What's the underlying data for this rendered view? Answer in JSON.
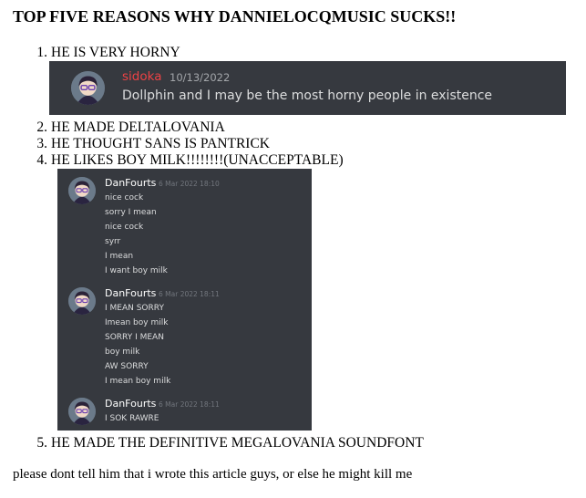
{
  "page": {
    "title": "TOP FIVE REASONS WHY DANNIELOCQMUSIC SUCKS!!",
    "closing": "please dont tell him that i wrote this article guys, or else he might kill me"
  },
  "list": [
    {
      "num": "1.",
      "text": "HE IS VERY HORNY"
    },
    {
      "num": "2.",
      "text": "HE MADE DELTALOVANIA"
    },
    {
      "num": "3.",
      "text": "HE THOUGHT SANS IS PANTRICK"
    },
    {
      "num": "4.",
      "text": "HE LIKES BOY MILK!!!!!!!!(UNACCEPTABLE)"
    },
    {
      "num": "5.",
      "text": "HE MADE THE DEFINITIVE MEGALOVANIA SOUNDFONT"
    }
  ],
  "embed1": {
    "username": "sidoka",
    "username_color": "#ed4245",
    "timestamp": "10/13/2022",
    "message": "Dollphin and I may be the most horny people in existence"
  },
  "embed2": {
    "groups": [
      {
        "username": "DanFourts",
        "timestamp": "6 Mar 2022 18:10",
        "lines": [
          "nice cock",
          "sorry I mean",
          "nice cock",
          "syrr",
          "I mean",
          "I want boy milk"
        ]
      },
      {
        "username": "DanFourts",
        "timestamp": "6 Mar 2022 18:11",
        "lines": [
          "I MEAN SORRY",
          "Imean boy milk",
          "SORRY I MEAN",
          "boy milk",
          "AW SORRY",
          "I mean boy milk"
        ]
      },
      {
        "username": "DanFourts",
        "timestamp": "6 Mar 2022 18:11",
        "lines": [
          "I SOK RAWRE"
        ]
      }
    ]
  },
  "colors": {
    "discord_bg": "#36393f",
    "message_text": "#dcddde",
    "timestamp_text": "#72767d",
    "username_text": "#ffffff"
  }
}
